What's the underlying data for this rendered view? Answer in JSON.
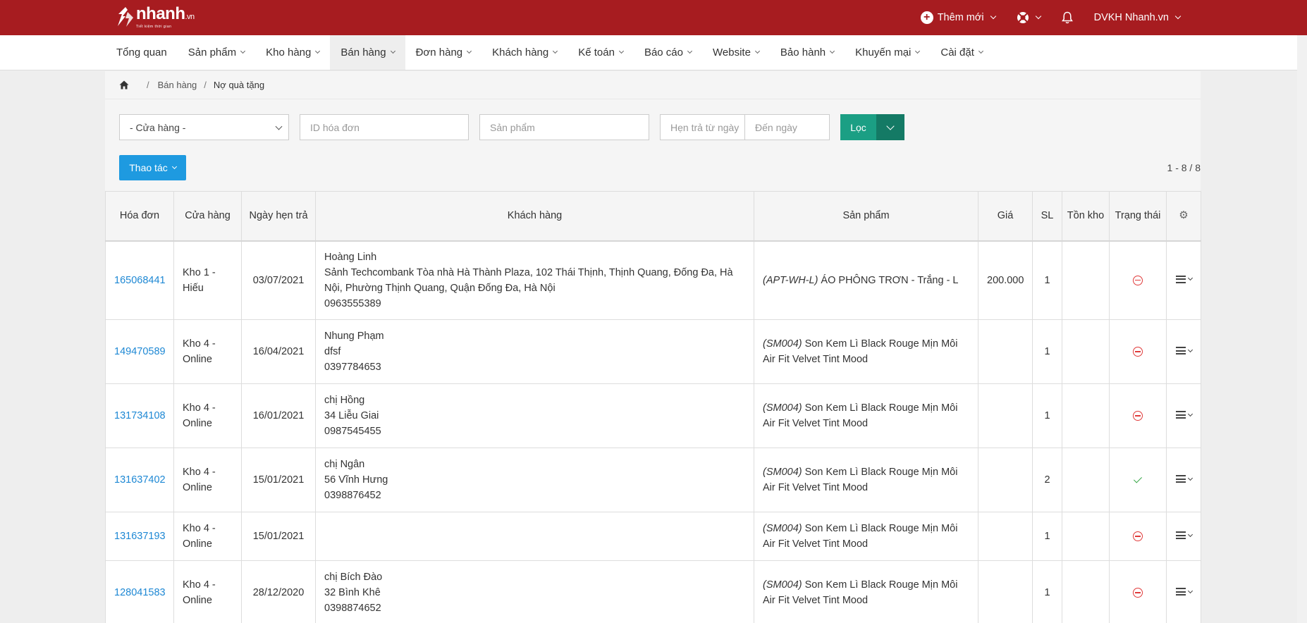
{
  "app": {
    "logo_text": "nhanh",
    "logo_suffix": ".vn",
    "logo_tagline": "Tiết kiệm thời gian"
  },
  "topbar": {
    "new_label": "Thêm mới",
    "user_label": "DVKH Nhanh.vn"
  },
  "nav": {
    "items": [
      {
        "label": "Tổng quan"
      },
      {
        "label": "Sản phẩm"
      },
      {
        "label": "Kho hàng"
      },
      {
        "label": "Bán hàng"
      },
      {
        "label": "Đơn hàng"
      },
      {
        "label": "Khách hàng"
      },
      {
        "label": "Kế toán"
      },
      {
        "label": "Báo cáo"
      },
      {
        "label": "Website"
      },
      {
        "label": "Bảo hành"
      },
      {
        "label": "Khuyến mại"
      },
      {
        "label": "Cài đặt"
      }
    ],
    "active": "Bán hàng"
  },
  "breadcrumb": {
    "items": [
      "Bán hàng",
      "Nợ quà tặng"
    ]
  },
  "filters": {
    "store_select": "- Cửa hàng -",
    "invoice_placeholder": "ID hóa đơn",
    "product_placeholder": "Sản phẩm",
    "from_date_placeholder": "Hẹn trả từ ngày",
    "to_date_placeholder": "Đến ngày",
    "filter_button": "Lọc",
    "actions_button": "Thao tác",
    "pager": "1 - 8 / 8"
  },
  "table": {
    "headers": {
      "invoice": "Hóa đơn",
      "store": "Cửa hàng",
      "due_date": "Ngày hẹn trả",
      "customer": "Khách hàng",
      "product": "Sản phẩm",
      "price": "Giá",
      "qty": "SL",
      "stock": "Tồn kho",
      "status": "Trạng thái"
    },
    "rows": [
      {
        "invoice": "165068441",
        "store": "Kho 1 - Hiếu",
        "due_date": "03/07/2021",
        "customer_name": "Hoàng Linh",
        "customer_address": "Sảnh Techcombank Tòa nhà Hà Thành Plaza, 102 Thái Thịnh, Thịnh Quang, Đống Đa, Hà Nội, Phường Thịnh Quang, Quận Đống Đa, Hà Nội",
        "customer_phone": "0963555389",
        "product_sku": "(APT-WH-L)",
        "product_name": " ÁO PHÔNG TRƠN - Trắng - L",
        "price": "200.000",
        "qty": "1",
        "stock": "",
        "status": "minus"
      },
      {
        "invoice": "149470589",
        "store": "Kho 4 - Online",
        "due_date": "16/04/2021",
        "customer_name": "Nhung Phạm",
        "customer_address": "dfsf",
        "customer_phone": "0397784653",
        "product_sku": "(SM004)",
        "product_name": " Son Kem Lì Black Rouge Mịn Môi Air Fit Velvet Tint Mood",
        "price": "",
        "qty": "1",
        "stock": "",
        "status": "minus"
      },
      {
        "invoice": "131734108",
        "store": "Kho 4 - Online",
        "due_date": "16/01/2021",
        "customer_name": "chị Hồng",
        "customer_address": "34 Liễu Giai",
        "customer_phone": "0987545455",
        "product_sku": "(SM004)",
        "product_name": " Son Kem Lì Black Rouge Mịn Môi Air Fit Velvet Tint Mood",
        "price": "",
        "qty": "1",
        "stock": "",
        "status": "minus"
      },
      {
        "invoice": "131637402",
        "store": "Kho 4 - Online",
        "due_date": "15/01/2021",
        "customer_name": "chị Ngân",
        "customer_address": "56 Vĩnh Hưng",
        "customer_phone": "0398876452",
        "product_sku": "(SM004)",
        "product_name": " Son Kem Lì Black Rouge Mịn Môi Air Fit Velvet Tint Mood",
        "price": "",
        "qty": "2",
        "stock": "",
        "status": "check"
      },
      {
        "invoice": "131637193",
        "store": "Kho 4 - Online",
        "due_date": "15/01/2021",
        "customer_name": "",
        "customer_address": "",
        "customer_phone": "",
        "product_sku": "(SM004)",
        "product_name": " Son Kem Lì Black Rouge Mịn Môi Air Fit Velvet Tint Mood",
        "price": "",
        "qty": "1",
        "stock": "",
        "status": "minus"
      },
      {
        "invoice": "128041583",
        "store": "Kho 4 - Online",
        "due_date": "28/12/2020",
        "customer_name": "chị Bích Đào",
        "customer_address": "32 Bình Khê",
        "customer_phone": "0398874652",
        "product_sku": "(SM004)",
        "product_name": " Son Kem Lì Black Rouge Mịn Môi Air Fit Velvet Tint Mood",
        "price": "",
        "qty": "1",
        "stock": "",
        "status": "minus"
      }
    ]
  },
  "colors": {
    "brand": "#a71c20",
    "filter_button": "#1b9f84",
    "actions_button": "#1e9ae0",
    "link": "#1e88d4",
    "status_minus": "#e03a3a",
    "status_check": "#3aa84a"
  }
}
